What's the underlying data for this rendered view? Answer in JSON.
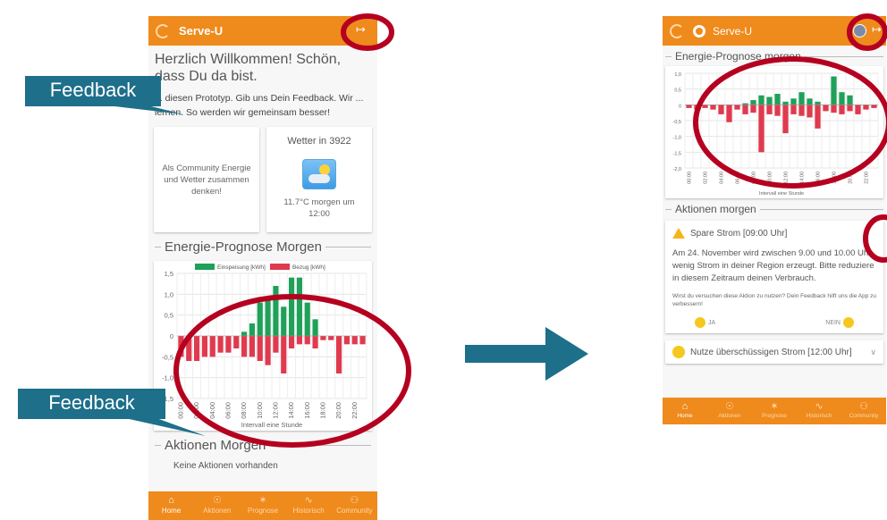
{
  "left_app": {
    "app_title": "Serve-U",
    "welcome": "Herzlich Willkommen! Schön, dass Du da bist.",
    "intro": "... diesen Prototyp. Gib uns Dein Feedback. Wir ... lernen. So werden wir gemeinsam besser!",
    "community_card": "Als Community Energie und Wetter zusammen denken!",
    "weather_title": "Wetter in 3922",
    "weather_value": "11.7°C morgen um 12:00",
    "forecast_heading": "Energie-Prognose Morgen",
    "legend": [
      "Einspeisung [kWh]",
      "Bezug [kWh]"
    ],
    "x_axis_label": "Intervall eine Stunde",
    "actions_heading": "Aktionen Morgen",
    "no_actions": "Keine Aktionen vorhanden",
    "tabs": [
      "Home",
      "Aktionen",
      "Prognose",
      "Historisch",
      "Community"
    ]
  },
  "right_app": {
    "app_title": "Serve-U",
    "forecast_heading": "Energie-Prognose morgen",
    "x_axis_label": "Intervall eine Stunde",
    "actions_heading": "Aktionen morgen",
    "action1_title": "Spare Strom [09:00 Uhr]",
    "action1_body": "Am 24. November wird zwischen 9.00 und 10.00 Uhr wenig Strom in deiner Region erzeugt. Bitte reduziere in diesem Zeitraum deinen Verbrauch.",
    "action1_question": "Wirst du versuchen diese Aktion zu nutzen? Dein Feedback hilft uns die App zu verbessern!",
    "yes_label": "JA",
    "no_label": "NEIN",
    "action2_title": "Nutze überschüssigen Strom [12:00 Uhr]",
    "tabs": [
      "Home",
      "Aktionen",
      "Prognose",
      "Historisch",
      "Community"
    ]
  },
  "callouts": [
    "Feedback",
    "Feedback"
  ],
  "colors": {
    "orange": "#ef8a1c",
    "feed_in_green": "#1fa15a",
    "demand_red": "#e03a4e",
    "callout_teal": "#1d6f8a",
    "highlight_circle": "#b5001f"
  },
  "chart_data": [
    {
      "type": "bar",
      "title": "Energie-Prognose Morgen",
      "xlabel": "Intervall eine Stunde",
      "categories": [
        "00:00",
        "01:00",
        "02:00",
        "03:00",
        "04:00",
        "05:00",
        "06:00",
        "07:00",
        "08:00",
        "09:00",
        "10:00",
        "11:00",
        "12:00",
        "13:00",
        "14:00",
        "15:00",
        "16:00",
        "17:00",
        "18:00",
        "19:00",
        "20:00",
        "21:00",
        "22:00",
        "23:00"
      ],
      "series": [
        {
          "name": "Einspeisung [kWh]",
          "values": [
            0,
            0,
            0,
            0,
            0,
            0,
            0,
            0,
            0.1,
            0.3,
            0.8,
            0.9,
            1.2,
            0.7,
            1.4,
            1.4,
            0.8,
            0.4,
            0,
            0,
            0,
            0,
            0,
            0
          ]
        },
        {
          "name": "Bezug [kWh]",
          "values": [
            -0.5,
            -0.6,
            -0.6,
            -0.5,
            -0.5,
            -0.4,
            -0.4,
            -0.3,
            -0.5,
            -0.5,
            -0.6,
            -0.7,
            -0.4,
            -0.9,
            -0.3,
            -0.2,
            -0.2,
            -0.3,
            -0.1,
            -0.1,
            -0.9,
            -0.2,
            -0.2,
            -0.2
          ]
        }
      ],
      "ytick_labels": [
        "1,5",
        "1,0",
        "0,5",
        "0",
        "-0,5",
        "-1,0",
        "-1,5"
      ],
      "ylim": [
        -1.5,
        1.5
      ]
    },
    {
      "type": "bar",
      "title": "Energie-Prognose morgen",
      "xlabel": "Intervall eine Stunde",
      "categories": [
        "00:00",
        "01:00",
        "02:00",
        "03:00",
        "04:00",
        "05:00",
        "06:00",
        "07:00",
        "08:00",
        "09:00",
        "10:00",
        "11:00",
        "12:00",
        "13:00",
        "14:00",
        "15:00",
        "16:00",
        "17:00",
        "18:00",
        "19:00",
        "20:00",
        "21:00",
        "22:00",
        "23:00"
      ],
      "series": [
        {
          "name": "Einspeisung [kWh]",
          "values": [
            0,
            0,
            0,
            0,
            0,
            0,
            0,
            0.05,
            0.15,
            0.3,
            0.25,
            0.35,
            0.1,
            0.2,
            0.4,
            0.2,
            0.1,
            0,
            0.9,
            0.4,
            0.3,
            0,
            0,
            0
          ]
        },
        {
          "name": "Bezug [kWh]",
          "values": [
            -0.1,
            -0.15,
            -0.1,
            -0.15,
            -0.3,
            -0.55,
            -0.15,
            -0.3,
            -0.25,
            -1.5,
            -0.3,
            -0.35,
            -0.9,
            -0.3,
            -0.35,
            -0.4,
            -0.75,
            -0.2,
            -0.25,
            -0.3,
            -0.2,
            -0.3,
            -0.15,
            -0.1
          ]
        }
      ],
      "ytick_labels": [
        "1,0",
        "0,5",
        "0",
        "-0,5",
        "-1,0",
        "-1,5",
        "-2,0"
      ],
      "ylim": [
        -2.0,
        1.0
      ]
    }
  ]
}
